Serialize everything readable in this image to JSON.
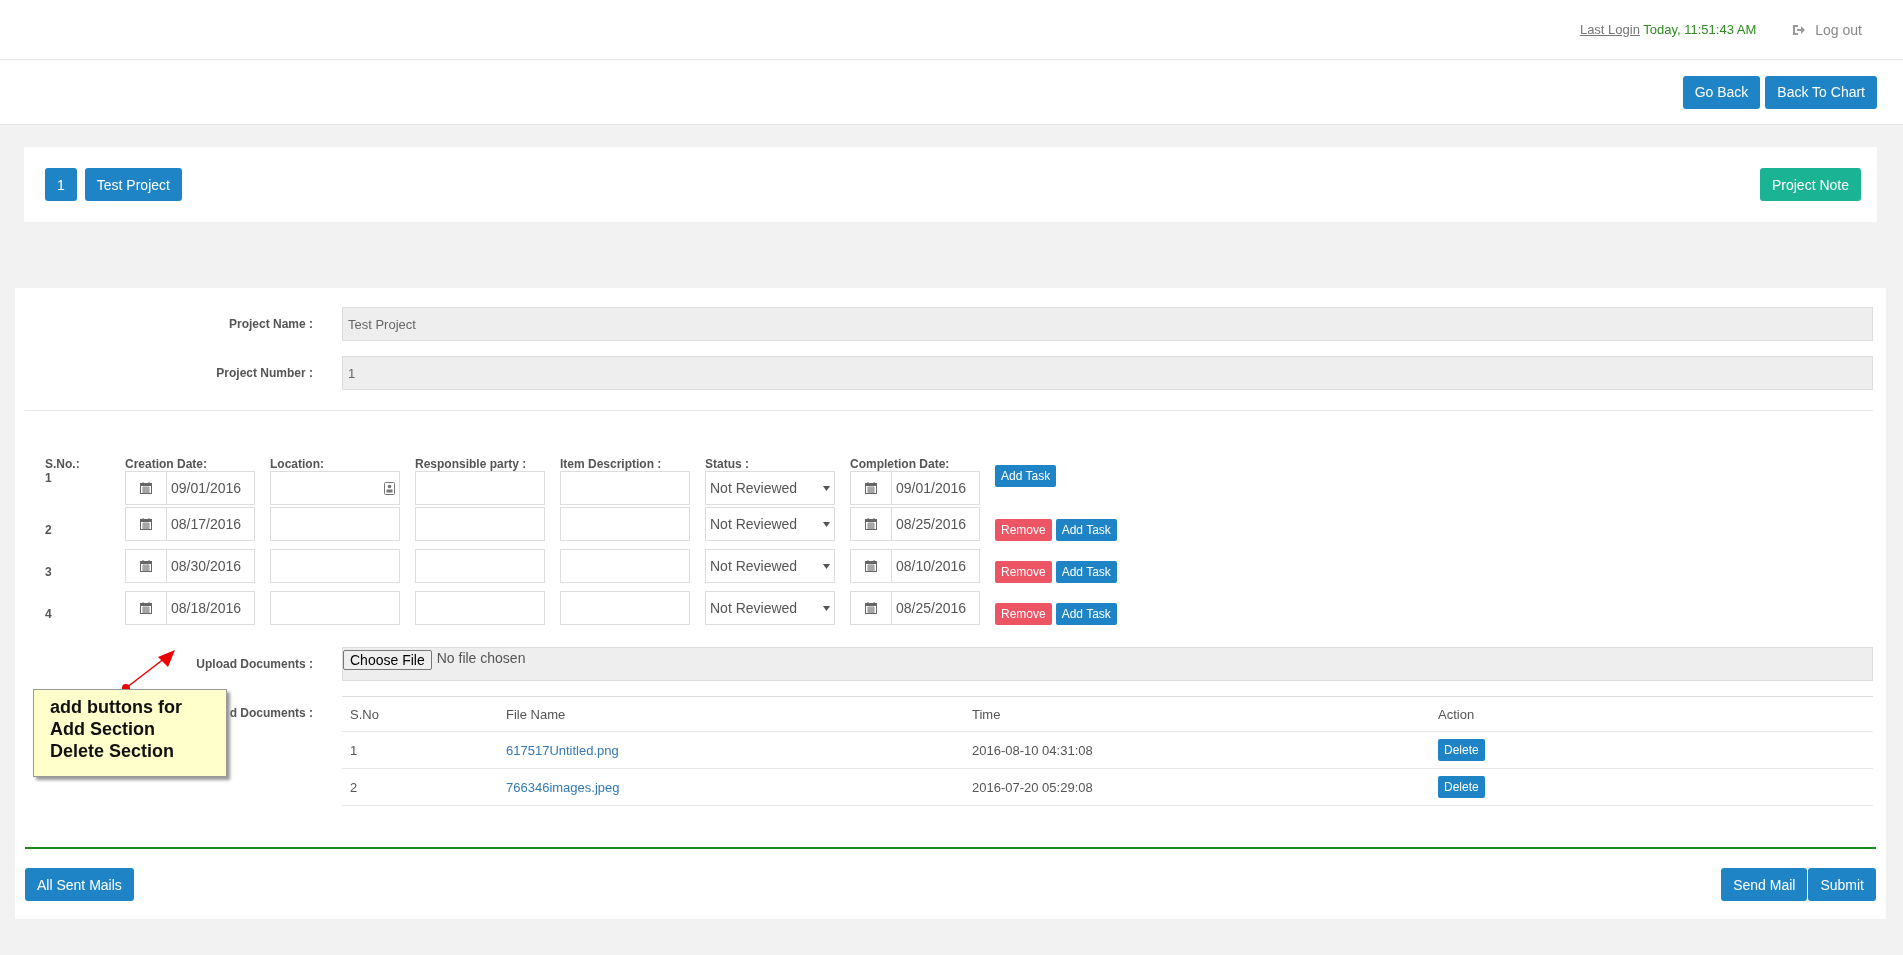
{
  "header": {
    "last_login_label": "Last Login",
    "last_login_value": "Today, 11:51:43 AM",
    "logout": "Log out"
  },
  "nav_buttons": [
    "Go Back",
    "Back To Chart"
  ],
  "project_bar": {
    "number": "1",
    "name": "Test Project",
    "note_button": "Project Note"
  },
  "fields": [
    {
      "label": "Project Name :",
      "value": "Test Project"
    },
    {
      "label": "Project Number :",
      "value": "1"
    }
  ],
  "tasks": {
    "columns": [
      "S.No.:",
      "Creation Date:",
      "Location:",
      "Responsible party :",
      "Item Description :",
      "Status :",
      "Completion Date:"
    ],
    "rows": [
      {
        "sno": "1",
        "creation_date": "09/01/2016",
        "location_icon": true,
        "status": "Not Reviewed",
        "completion_date": "09/01/2016",
        "actions": [
          {
            "kind": "add",
            "label": "Add Task"
          }
        ]
      },
      {
        "sno": "2",
        "creation_date": "08/17/2016",
        "location_icon": false,
        "status": "Not Reviewed",
        "completion_date": "08/25/2016",
        "actions": [
          {
            "kind": "remove",
            "label": "Remove"
          },
          {
            "kind": "add",
            "label": "Add Task"
          }
        ]
      },
      {
        "sno": "3",
        "creation_date": "08/30/2016",
        "location_icon": false,
        "status": "Not Reviewed",
        "completion_date": "08/10/2016",
        "actions": [
          {
            "kind": "remove",
            "label": "Remove"
          },
          {
            "kind": "add",
            "label": "Add Task"
          }
        ]
      },
      {
        "sno": "4",
        "creation_date": "08/18/2016",
        "location_icon": false,
        "status": "Not Reviewed",
        "completion_date": "08/25/2016",
        "actions": [
          {
            "kind": "remove",
            "label": "Remove"
          },
          {
            "kind": "add",
            "label": "Add Task"
          }
        ]
      }
    ]
  },
  "upload": {
    "label": "Upload Documents :",
    "button": "Choose File",
    "status": "No file chosen"
  },
  "documents": {
    "label": "d Documents :",
    "columns": [
      "S.No",
      "File Name",
      "Time",
      "Action"
    ],
    "rows": [
      {
        "sno": "1",
        "file": "617517Untitled.png",
        "time": "2016-08-10 04:31:08",
        "action": "Delete"
      },
      {
        "sno": "2",
        "file": "766346images.jpeg",
        "time": "2016-07-20 05:29:08",
        "action": "Delete"
      }
    ]
  },
  "footer": {
    "left_button": "All Sent Mails",
    "right_buttons": [
      "Send Mail",
      "Submit"
    ]
  },
  "callout": {
    "text": "add buttons for\nAdd Section\nDelete Section"
  }
}
